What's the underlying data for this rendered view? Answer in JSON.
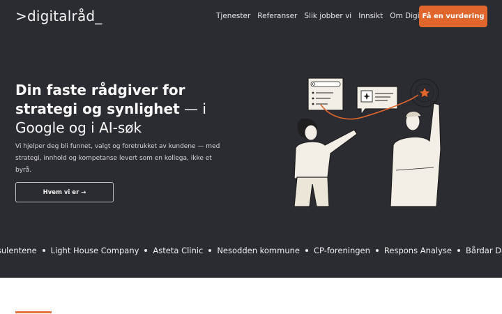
{
  "header": {
    "logo_text": ">digitalråd_",
    "nav": [
      "Tjenester",
      "Referanser",
      "Slik jobber vi",
      "Innsikt",
      "Om Digitalråd"
    ],
    "cta_label": "Få en vurdering"
  },
  "hero": {
    "title_bold": "Din faste rådgiver for strategi og synlighet",
    "title_rest": " — i Google og i AI-søk",
    "lead": "Vi hjelper deg bli funnet, valgt og foretrukket av kundene — med strategi, innhold og kompetanse levert som en kollega, ikke et byrå.",
    "button_label": "Hvem vi er →",
    "illustration_icon": "consultants-illustration"
  },
  "ticker": {
    "items": [
      "nkonsulentene",
      "Light House Company",
      "Asteta Clinic",
      "Nesodden kommune",
      "CP-foreningen",
      "Respons Analyse",
      "Bårdar Danseinstitutt"
    ]
  },
  "colors": {
    "background": "#2b2c32",
    "accent": "#e0662c",
    "text": "#ffffff"
  }
}
